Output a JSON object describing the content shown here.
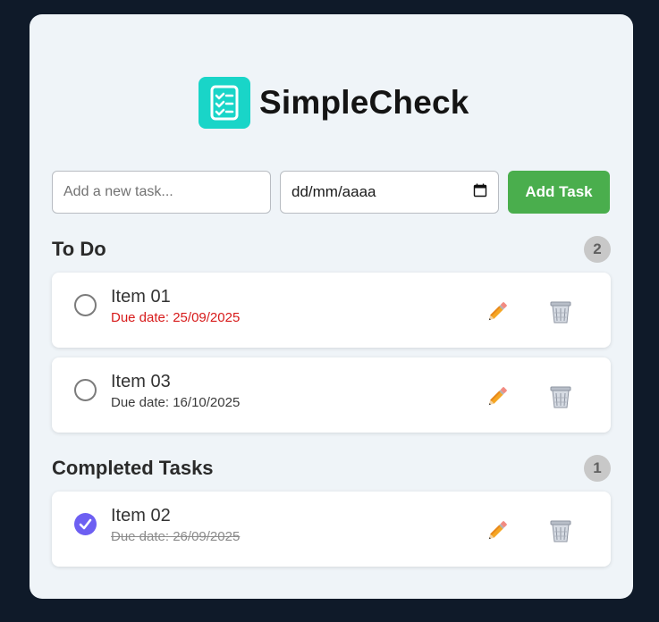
{
  "app": {
    "name": "SimpleCheck",
    "logo_icon": "checklist-icon"
  },
  "new_task": {
    "placeholder": "Add a new task...",
    "value": "",
    "date_placeholder": "dd/mm/aaaa",
    "date_icon": "calendar-icon",
    "add_label": "Add Task",
    "add_color": "#4aae4d"
  },
  "todo": {
    "title": "To Do",
    "count": "2",
    "items": [
      {
        "name": "Item 01",
        "due": "Due date: 25/09/2025",
        "status": "overdue",
        "due_color": "#d71a1a"
      },
      {
        "name": "Item 03",
        "due": "Due date: 16/10/2025",
        "status": "pending"
      }
    ]
  },
  "completed": {
    "title": "Completed Tasks",
    "count": "1",
    "items": [
      {
        "name": "Item 02",
        "due": "Due date: 26/09/2025",
        "status": "done",
        "check_color": "#6d5ff2"
      }
    ]
  },
  "icons": {
    "edit": "pencil-icon",
    "delete": "trash-icon",
    "done": "checkmark-icon"
  }
}
